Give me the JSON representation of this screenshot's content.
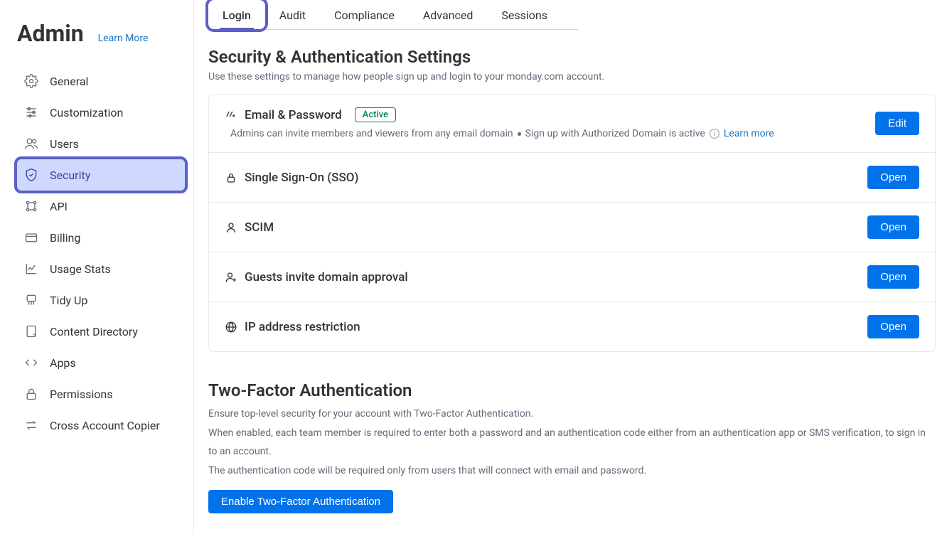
{
  "sidebar": {
    "title": "Admin",
    "learn_more": "Learn More",
    "items": [
      {
        "label": "General",
        "icon": "gear"
      },
      {
        "label": "Customization",
        "icon": "sliders"
      },
      {
        "label": "Users",
        "icon": "users"
      },
      {
        "label": "Security",
        "icon": "shield",
        "active": true
      },
      {
        "label": "API",
        "icon": "api"
      },
      {
        "label": "Billing",
        "icon": "card"
      },
      {
        "label": "Usage Stats",
        "icon": "chart"
      },
      {
        "label": "Tidy Up",
        "icon": "broom"
      },
      {
        "label": "Content Directory",
        "icon": "doc"
      },
      {
        "label": "Apps",
        "icon": "code"
      },
      {
        "label": "Permissions",
        "icon": "lock"
      },
      {
        "label": "Cross Account Copier",
        "icon": "swap"
      }
    ]
  },
  "tabs": [
    "Login",
    "Audit",
    "Compliance",
    "Advanced",
    "Sessions"
  ],
  "active_tab": "Login",
  "security": {
    "title": "Security & Authentication Settings",
    "desc": "Use these settings to manage how people sign up and login to your monday.com account.",
    "cards": [
      {
        "icon": "monday",
        "title": "Email & Password",
        "badge": "Active",
        "sub1": "Admins can invite members and viewers from any email domain",
        "sub2": "Sign up with Authorized Domain is active",
        "learn_more": "Learn more",
        "button": "Edit"
      },
      {
        "icon": "lock",
        "title": "Single Sign-On (SSO)",
        "button": "Open"
      },
      {
        "icon": "person",
        "title": "SCIM",
        "button": "Open"
      },
      {
        "icon": "person-plus",
        "title": "Guests invite domain approval",
        "button": "Open"
      },
      {
        "icon": "globe",
        "title": "IP address restriction",
        "button": "Open"
      }
    ]
  },
  "twofa": {
    "title": "Two-Factor Authentication",
    "desc1": "Ensure top-level security for your account with Two-Factor Authentication.",
    "desc2": "When enabled, each team member is required to enter both a password and an authentication code either from an authentication app or SMS verification, to sign in to an account.",
    "desc3": "The authentication code will be required only from users that will connect with email and password.",
    "button": "Enable Two-Factor Authentication"
  }
}
